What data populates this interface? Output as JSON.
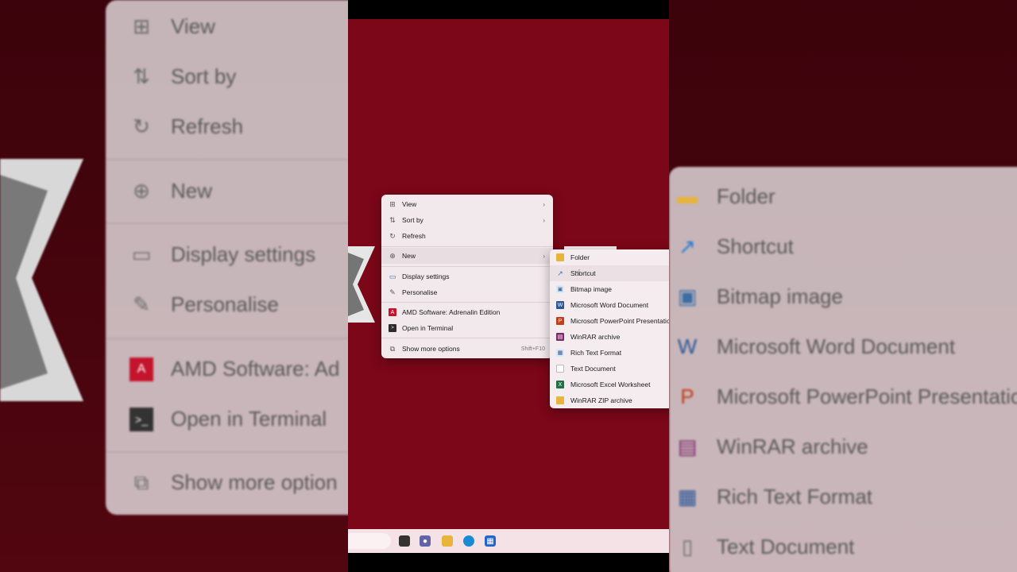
{
  "context_menu": {
    "items": [
      {
        "label": "View",
        "icon": "view-grid-icon",
        "has_submenu": true
      },
      {
        "label": "Sort by",
        "icon": "sort-icon",
        "has_submenu": true
      },
      {
        "label": "Refresh",
        "icon": "refresh-icon",
        "has_submenu": false
      },
      {
        "label": "New",
        "icon": "new-plus-icon",
        "has_submenu": true
      },
      {
        "label": "Display settings",
        "icon": "display-settings-icon",
        "has_submenu": false
      },
      {
        "label": "Personalise",
        "icon": "pen-icon",
        "has_submenu": false
      },
      {
        "label": "AMD Software: Adrenalin Edition",
        "icon": "amd-icon",
        "has_submenu": false
      },
      {
        "label": "Open in Terminal",
        "icon": "terminal-icon",
        "has_submenu": false
      },
      {
        "label": "Show more options",
        "icon": "show-more-icon",
        "shortcut": "Shift+F10"
      }
    ]
  },
  "new_submenu": {
    "items": [
      {
        "label": "Folder",
        "icon": "folder-icon"
      },
      {
        "label": "Shortcut",
        "icon": "shortcut-arrow-icon"
      },
      {
        "label": "Bitmap image",
        "icon": "bitmap-icon"
      },
      {
        "label": "Microsoft Word Document",
        "icon": "word-icon"
      },
      {
        "label": "Microsoft PowerPoint Presentation",
        "icon": "powerpoint-icon"
      },
      {
        "label": "WinRAR archive",
        "icon": "winrar-icon"
      },
      {
        "label": "Rich Text Format",
        "icon": "rtf-icon"
      },
      {
        "label": "Text Document",
        "icon": "text-document-icon"
      },
      {
        "label": "Microsoft Excel Worksheet",
        "icon": "excel-icon"
      },
      {
        "label": "WinRAR ZIP archive",
        "icon": "zip-icon"
      }
    ]
  },
  "background_left": {
    "items": [
      "View",
      "Sort by",
      "Refresh",
      "New",
      "Display settings",
      "Personalise",
      "AMD Software: Ad",
      "Open in Terminal",
      "Show more option"
    ]
  },
  "background_right": {
    "items": [
      "Folder",
      "Shortcut",
      "Bitmap image",
      "Microsoft Word Document",
      "Microsoft PowerPoint Presentatio",
      "WinRAR archive",
      "Rich Text Format",
      "Text Document"
    ]
  },
  "colors": {
    "desktop": "#7b0718",
    "menu_bg": "#f2e9ec",
    "taskbar": "#f4e2e6"
  }
}
